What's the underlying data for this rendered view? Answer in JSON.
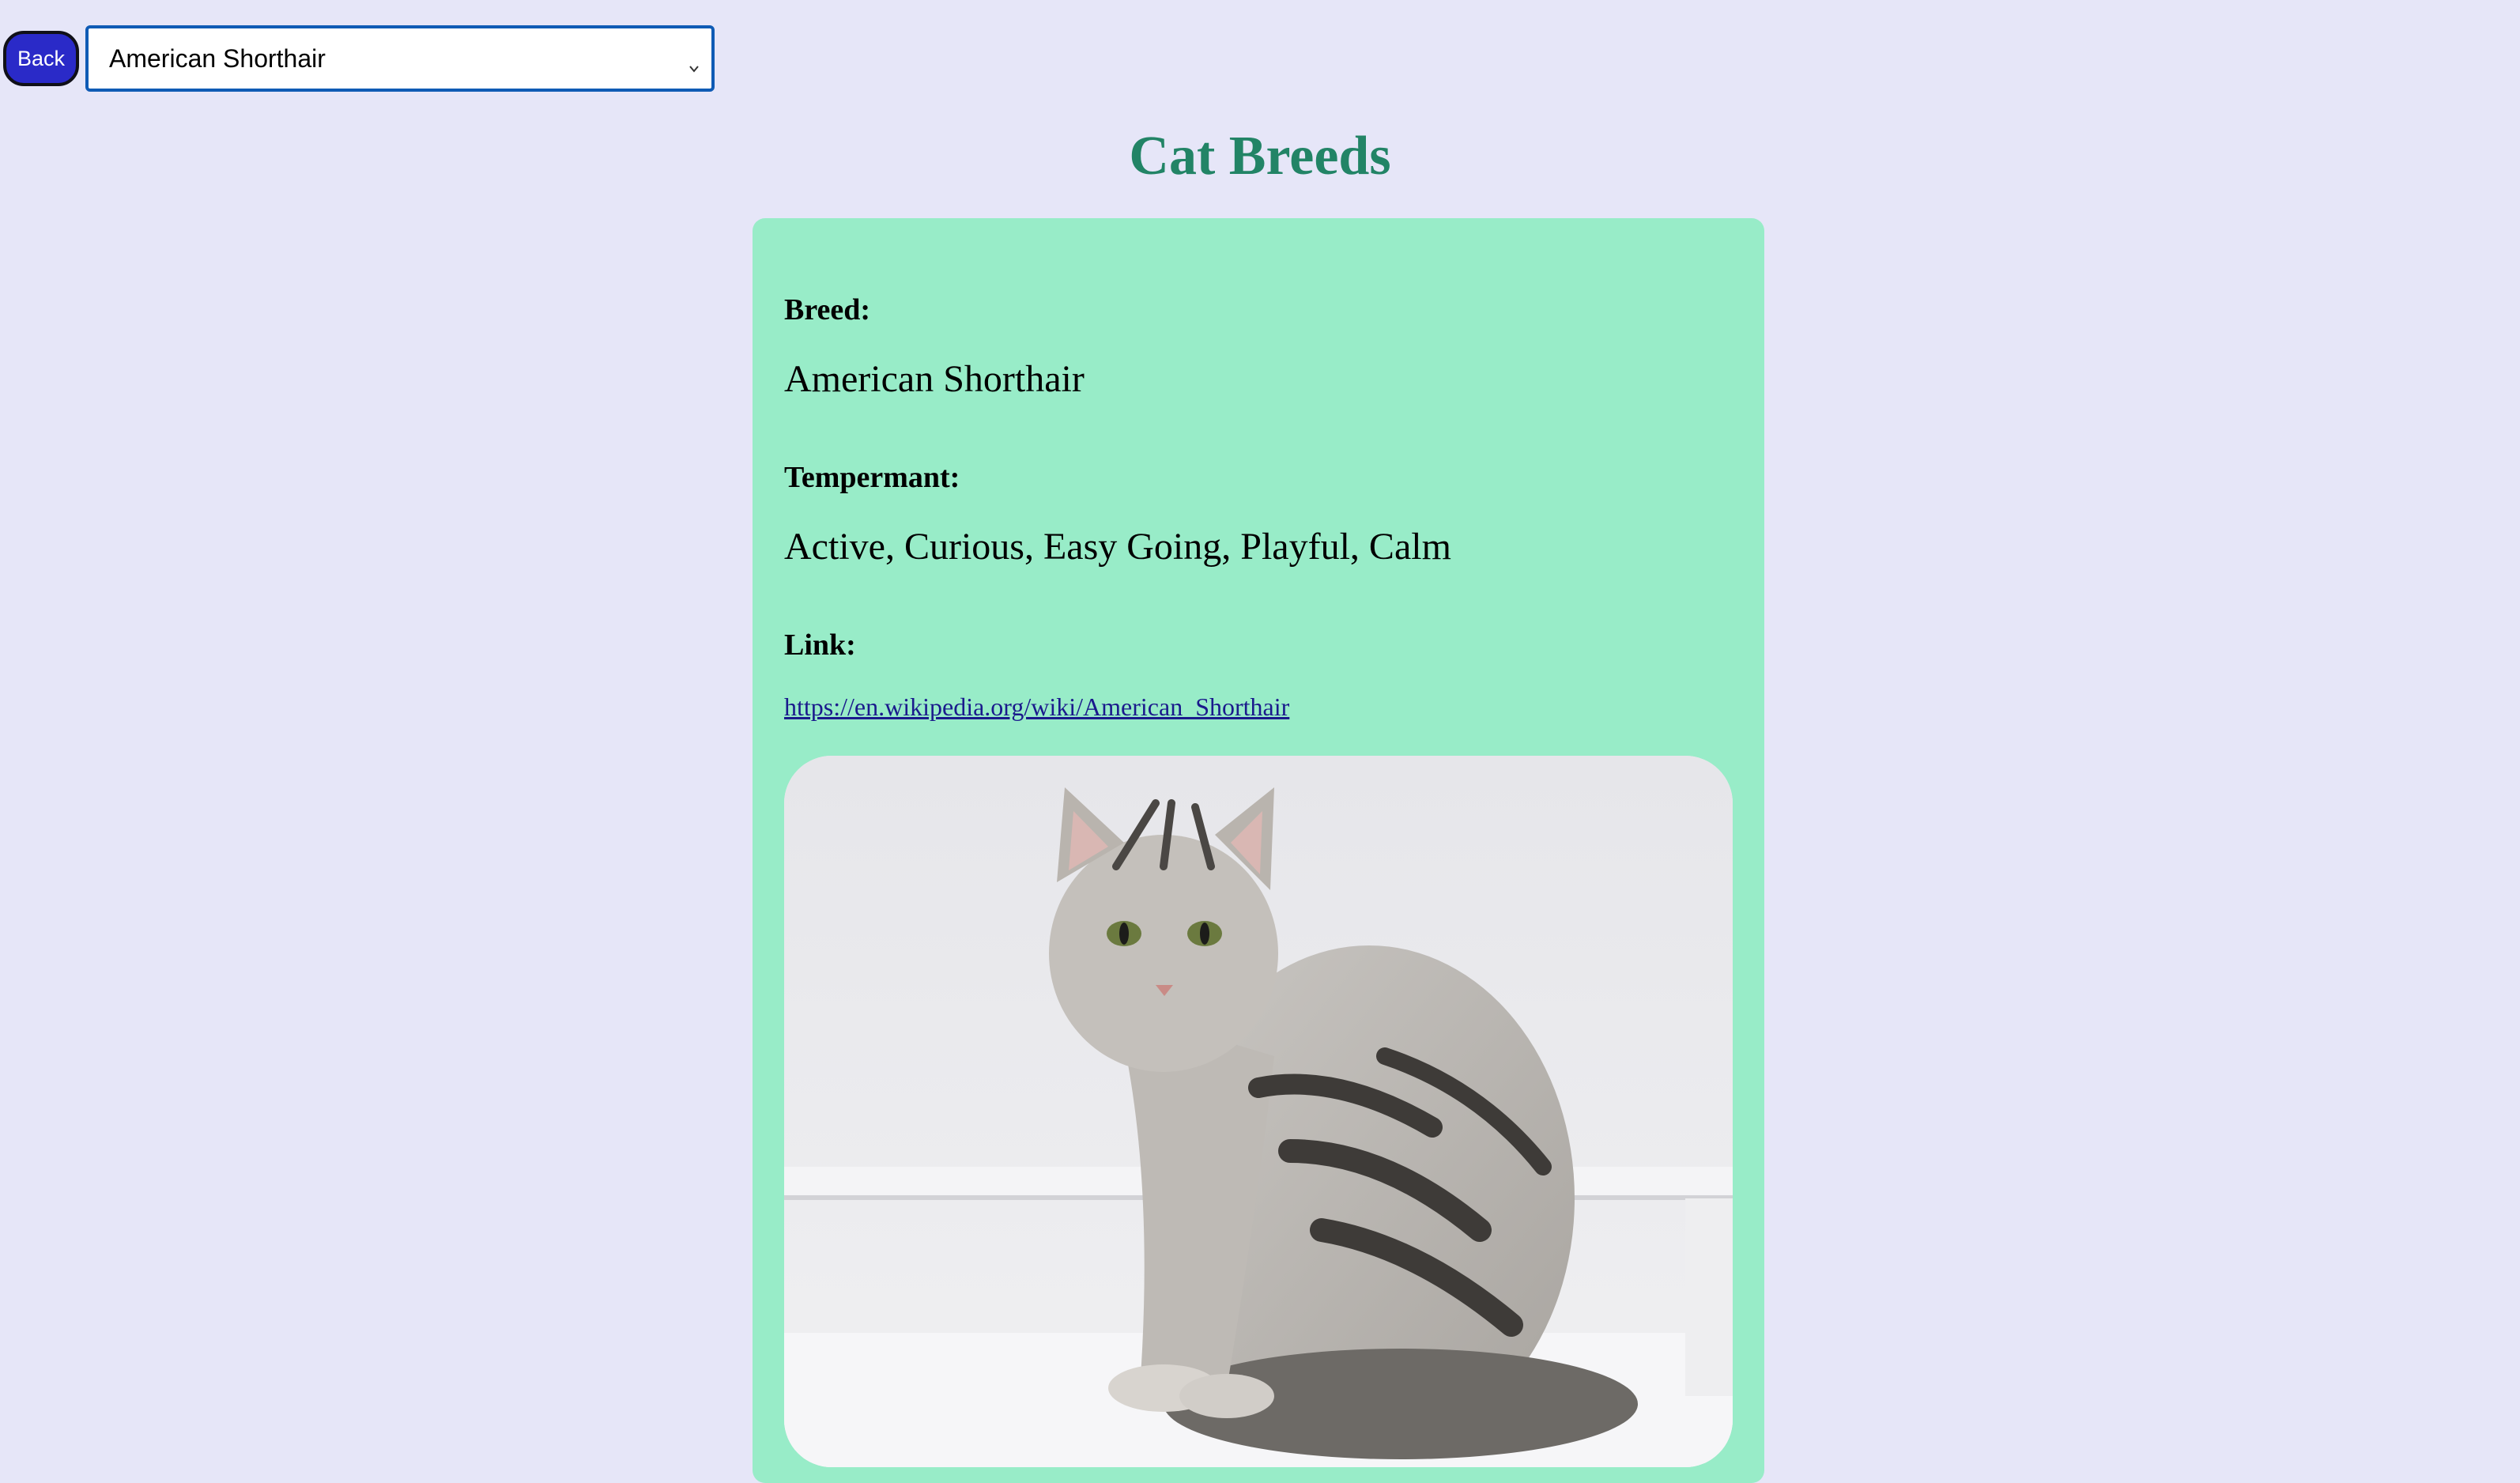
{
  "toolbar": {
    "back_label": "Back",
    "selected_breed": "American Shorthair"
  },
  "page": {
    "title": "Cat Breeds"
  },
  "card": {
    "breed_label": "Breed:",
    "breed_value": "American Shorthair",
    "temperament_label": "Tempermant:",
    "temperament_value": "Active, Curious, Easy Going, Playful, Calm",
    "link_label": "Link:",
    "link_value": "https://en.wikipedia.org/wiki/American_Shorthair"
  },
  "colors": {
    "background": "#e6e6f8",
    "card": "#98ecc8",
    "title": "#228466",
    "back_button": "#2a2ac8",
    "link": "#1a1a8c"
  },
  "icons": {
    "select_chevron": "chevron-down-icon"
  }
}
